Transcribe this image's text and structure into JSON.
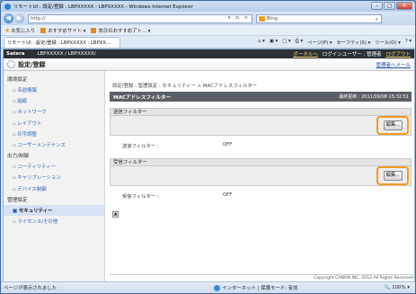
{
  "window": {
    "title": "リモートUI : 設定/登録 : LBPXXXXX : LBPXXXXX - Windows Internet Explorer",
    "min": "–",
    "max": "□",
    "close": "✕"
  },
  "addressbar": {
    "back": "◀",
    "forward": "▶",
    "url": "http://",
    "tools": "▾ ⇆ ✕",
    "search_value": "Bing",
    "search_icon": "⌕"
  },
  "favorites": {
    "label": "お気に入り",
    "items": [
      "おすすめサイト ▾",
      "本日のおすすめアト... ▾"
    ]
  },
  "tab": {
    "label": "リモートUI : 設定/登録 : LBPXXXXX : LBPXX...",
    "commands": [
      "⌂ ▾",
      "▣ ▾",
      "□ ▾",
      "⎙ ▾",
      "ページ(P) ▾",
      "セーフティ(S) ▾",
      "ツール(O) ▾",
      "? ▾"
    ]
  },
  "header": {
    "brand": "Satera",
    "model": "LBPXXXXX / LBPXXXXX/",
    "links": [
      "ポータルへ",
      "ログインユーザー : 管理者",
      "ログアウト"
    ]
  },
  "subheader": {
    "title": "設定/登録",
    "mgmt_link": "管理者へメール"
  },
  "sidebar": {
    "sections": [
      {
        "label": "環境設定",
        "items": [
          "名前情報",
          "給紙",
          "ネットワーク",
          "レイアウト",
          "印字調整",
          "ユーザーメンテナンス"
        ]
      },
      {
        "label": "出力/制御",
        "items": [
          "ユーティリティー",
          "キャリブレーション",
          "デバイス制御"
        ]
      },
      {
        "label": "管理設定",
        "items": [
          "セキュリティー",
          "ライセンス/その他"
        ]
      }
    ],
    "active": "セキュリティー"
  },
  "main": {
    "breadcrumb": "設定/登録 : 管理設定 : セキュリティー > MACアドレスフィルター",
    "title": "MACアドレスフィルター",
    "date": "最終更新 : 2011/09/08 15:32:51",
    "filters": [
      {
        "header": "送信フィルター",
        "edit": "編集...",
        "label": "送信フィルター :",
        "value": "OFF"
      },
      {
        "header": "受信フィルター",
        "edit": "編集...",
        "label": "受信フィルター :",
        "value": "OFF"
      }
    ],
    "top_button": "▲",
    "copyright": "Copyright CANON INC. 2012 All Rights Reserved"
  },
  "status": {
    "left": "ページが表示されました",
    "zone": "インターネット | 保護モード: 有効",
    "zoom": "🔍 100% ▾"
  }
}
